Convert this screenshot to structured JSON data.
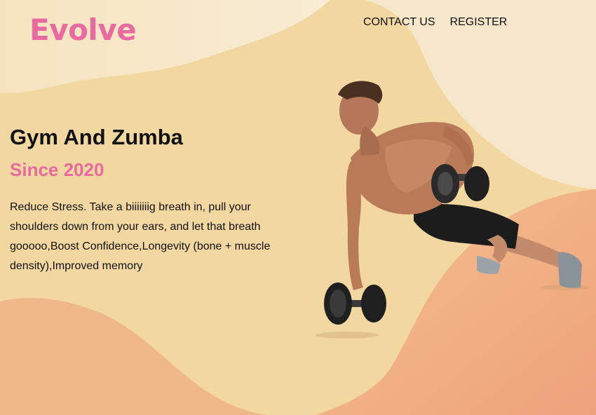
{
  "brand": {
    "name": "Evolve",
    "color": "#e86aa0"
  },
  "nav": {
    "items": [
      {
        "label": "CONTACT US"
      },
      {
        "label": "REGISTER"
      }
    ]
  },
  "hero": {
    "title": "Gym And Zumba",
    "subtitle": "Since 2020",
    "description": "Reduce Stress. Take a biiiiiiig breath in, pull your shoulders down from your ears, and let that breath gooooo,Boost Confidence,Longevity (bone + muscle density),Improved memory",
    "image": "man-doing-dumbbell-pushup"
  },
  "colors": {
    "accent": "#e86aa0",
    "background": "#f2d9a2",
    "wave_light": "#f6e7c6",
    "wave_peach": "#efb386"
  }
}
